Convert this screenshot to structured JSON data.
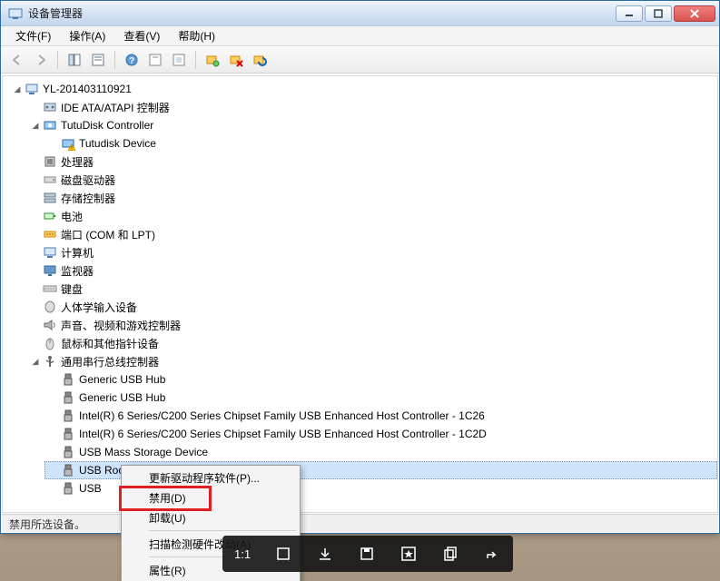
{
  "window": {
    "title": "设备管理器"
  },
  "menu": {
    "file": "文件(F)",
    "action": "操作(A)",
    "view": "查看(V)",
    "help": "帮助(H)"
  },
  "tree": {
    "root": "YL-201403110921",
    "nodes": [
      {
        "label": "IDE ATA/ATAPI 控制器",
        "icon": "ide"
      },
      {
        "label": "TutuDisk Controller",
        "icon": "disk",
        "expanded": true,
        "children": [
          {
            "label": "Tutudisk Device",
            "icon": "disk-warn"
          }
        ]
      },
      {
        "label": "处理器",
        "icon": "cpu"
      },
      {
        "label": "磁盘驱动器",
        "icon": "drive"
      },
      {
        "label": "存储控制器",
        "icon": "storage"
      },
      {
        "label": "电池",
        "icon": "battery"
      },
      {
        "label": "端口 (COM 和 LPT)",
        "icon": "port"
      },
      {
        "label": "计算机",
        "icon": "computer"
      },
      {
        "label": "监视器",
        "icon": "monitor"
      },
      {
        "label": "键盘",
        "icon": "keyboard"
      },
      {
        "label": "人体学输入设备",
        "icon": "hid"
      },
      {
        "label": "声音、视频和游戏控制器",
        "icon": "audio"
      },
      {
        "label": "鼠标和其他指针设备",
        "icon": "mouse"
      },
      {
        "label": "通用串行总线控制器",
        "icon": "usb",
        "expanded": true,
        "children": [
          {
            "label": "Generic USB Hub",
            "icon": "usb-plug"
          },
          {
            "label": "Generic USB Hub",
            "icon": "usb-plug"
          },
          {
            "label": "Intel(R) 6 Series/C200 Series Chipset Family USB Enhanced Host Controller - 1C26",
            "icon": "usb-plug"
          },
          {
            "label": "Intel(R) 6 Series/C200 Series Chipset Family USB Enhanced Host Controller - 1C2D",
            "icon": "usb-plug"
          },
          {
            "label": "USB Mass Storage Device",
            "icon": "usb-plug"
          },
          {
            "label": "USB Root Hub",
            "icon": "usb-plug",
            "selected": true
          },
          {
            "label": "USB",
            "icon": "usb-plug"
          }
        ]
      }
    ]
  },
  "context_menu": {
    "update_driver": "更新驱动程序软件(P)...",
    "disable": "禁用(D)",
    "uninstall": "卸载(U)",
    "scan": "扫描检测硬件改动(A)",
    "properties": "属性(R)"
  },
  "statusbar": "禁用所选设备。",
  "overlay": {
    "ratio": "1:1"
  }
}
